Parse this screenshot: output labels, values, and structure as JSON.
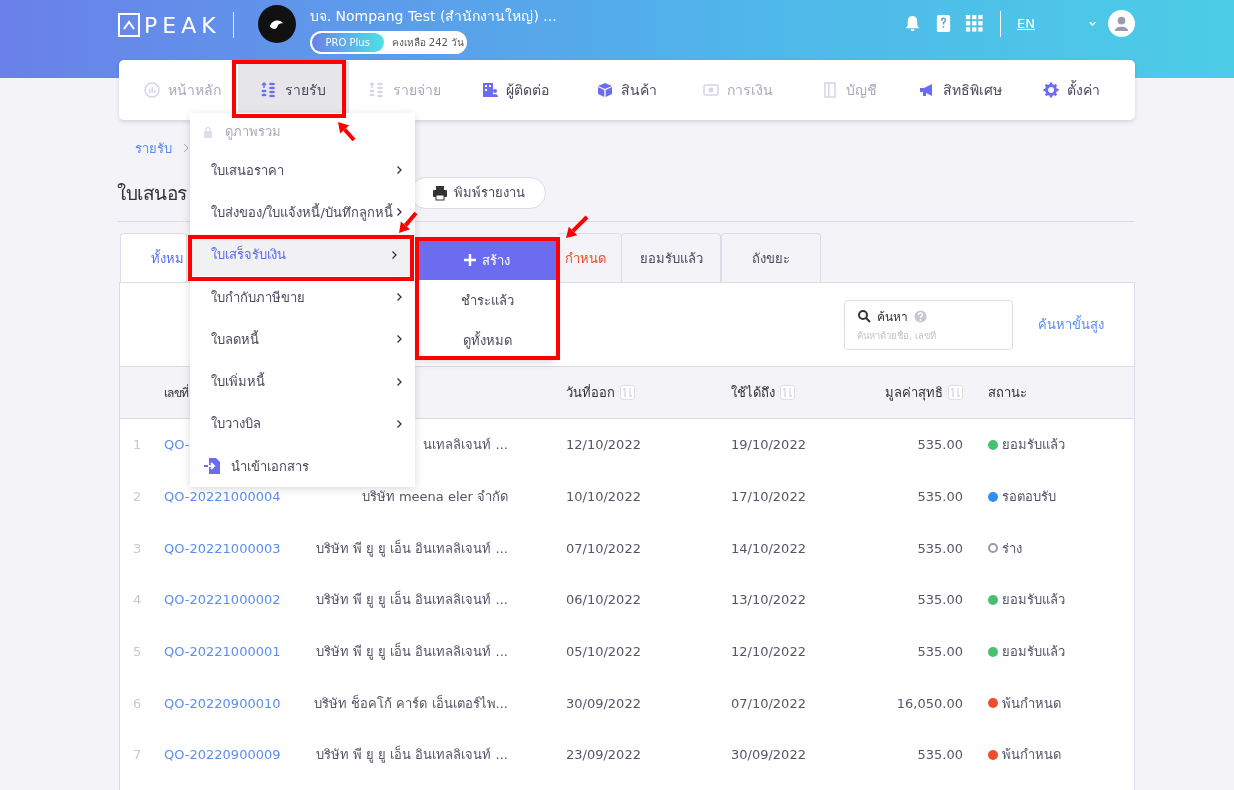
{
  "header": {
    "logo": "PEAK",
    "company": "บจ. Nompang Test (สำนักงานใหญ่) ...",
    "plan": "PRO Plus",
    "remaining": "คงเหลือ 242 วัน",
    "language": "EN"
  },
  "nav": [
    {
      "label": "หน้าหลัก",
      "disabled": true,
      "selected": false
    },
    {
      "label": "รายรับ",
      "disabled": false,
      "selected": true
    },
    {
      "label": "รายจ่าย",
      "disabled": true,
      "selected": false
    },
    {
      "label": "ผู้ติดต่อ",
      "disabled": false,
      "selected": false
    },
    {
      "label": "สินค้า",
      "disabled": false,
      "selected": false
    },
    {
      "label": "การเงิน",
      "disabled": true,
      "selected": false
    },
    {
      "label": "บัญชี",
      "disabled": true,
      "selected": false
    },
    {
      "label": "สิทธิพิเศษ",
      "disabled": false,
      "selected": false
    },
    {
      "label": "ตั้งค่า",
      "disabled": false,
      "selected": false
    }
  ],
  "breadcrumb": [
    "รายรับ"
  ],
  "page_title": "ใบเสนอร",
  "print_button": "พิมพ์รายงาน",
  "tabs": [
    {
      "label": "ทั้งหม",
      "kind": "normal",
      "selected": true
    },
    {
      "label": "กำหนด",
      "kind": "alert",
      "selected": false
    },
    {
      "label": "ยอมรับแล้ว",
      "kind": "normal",
      "selected": false
    },
    {
      "label": "ถังขยะ",
      "kind": "normal",
      "selected": false
    }
  ],
  "search": {
    "label": "ค้นหา",
    "placeholder": "ค้นหาด้วยชื่อ, เลขที่"
  },
  "advanced_search": "ค้นหาขั้นสูง",
  "table": {
    "columns": [
      {
        "label": "เลขที่",
        "sortable": false
      },
      {
        "label": "วันที่ออก",
        "sortable": true
      },
      {
        "label": "ใช้ได้ถึง",
        "sortable": true
      },
      {
        "label": "มูลค่าสุทธิ",
        "sortable": true
      },
      {
        "label": "สถานะ",
        "sortable": false
      }
    ],
    "rows": [
      {
        "index": "1",
        "number": "QO-",
        "customer": "นเทลลิเจนท์ ...",
        "issued": "12/10/2022",
        "valid_until": "19/10/2022",
        "amount": "535.00",
        "status": "ยอมรับแล้ว",
        "kind": "dot",
        "color": "#48c072"
      },
      {
        "index": "2",
        "number": "QO-20221000004",
        "customer": "บริษัท meena eler จำกัด",
        "issued": "10/10/2022",
        "valid_until": "17/10/2022",
        "amount": "535.00",
        "status": "รอตอบรับ",
        "kind": "dot",
        "color": "#2f8ff7"
      },
      {
        "index": "3",
        "number": "QO-20221000003",
        "customer": "บริษัท พี ยู ยู เอ็น อินเทลลิเจนท์ ...",
        "issued": "07/10/2022",
        "valid_until": "14/10/2022",
        "amount": "535.00",
        "status": "ร่าง",
        "kind": "ring",
        "color": "#9a98ab"
      },
      {
        "index": "4",
        "number": "QO-20221000002",
        "customer": "บริษัท พี ยู ยู เอ็น อินเทลลิเจนท์ ...",
        "issued": "06/10/2022",
        "valid_until": "13/10/2022",
        "amount": "535.00",
        "status": "ยอมรับแล้ว",
        "kind": "dot",
        "color": "#48c072"
      },
      {
        "index": "5",
        "number": "QO-20221000001",
        "customer": "บริษัท พี ยู ยู เอ็น อินเทลลิเจนท์ ...",
        "issued": "05/10/2022",
        "valid_until": "12/10/2022",
        "amount": "535.00",
        "status": "ยอมรับแล้ว",
        "kind": "dot",
        "color": "#48c072"
      },
      {
        "index": "6",
        "number": "QO-20220900010",
        "customer": "บริษัท ช็อคโก้ คาร์ด เอ็นเตอร์ไพ...",
        "issued": "30/09/2022",
        "valid_until": "07/10/2022",
        "amount": "16,050.00",
        "status": "พ้นกำหนด",
        "kind": "dot",
        "color": "#ef4d2e"
      },
      {
        "index": "7",
        "number": "QO-20220900009",
        "customer": "บริษัท พี ยู ยู เอ็น อินเทลลิเจนท์ ...",
        "issued": "23/09/2022",
        "valid_until": "30/09/2022",
        "amount": "535.00",
        "status": "พ้นกำหนด",
        "kind": "dot",
        "color": "#ef4d2e"
      }
    ]
  },
  "menu": [
    {
      "label": "ดูภาพรวม",
      "kind": "locked",
      "disabled": true,
      "selected": false
    },
    {
      "label": "ใบเสนอราคา",
      "kind": "submenu",
      "disabled": false,
      "selected": false
    },
    {
      "label": "ใบส่งของ/ใบแจ้งหนี้/บันทึกลูกหนี้",
      "kind": "submenu",
      "disabled": false,
      "selected": false
    },
    {
      "label": "ใบเสร็จรับเงิน",
      "kind": "submenu",
      "disabled": false,
      "selected": true
    },
    {
      "label": "ใบกำกับภาษีขาย",
      "kind": "submenu",
      "disabled": false,
      "selected": false
    },
    {
      "label": "ใบลดหนี้",
      "kind": "submenu",
      "disabled": false,
      "selected": false
    },
    {
      "label": "ใบเพิ่มหนี้",
      "kind": "submenu",
      "disabled": false,
      "selected": false
    },
    {
      "label": "ใบวางบิล",
      "kind": "submenu",
      "disabled": false,
      "selected": false
    },
    {
      "label": "นำเข้าเอกสาร",
      "kind": "import",
      "disabled": false,
      "selected": false
    }
  ],
  "submenu": [
    {
      "label": "สร้าง",
      "kind": "create",
      "selected": true
    },
    {
      "label": "ชำระแล้ว",
      "kind": "plain",
      "selected": false
    },
    {
      "label": "ดูทั้งหมด",
      "kind": "plain",
      "selected": false
    }
  ]
}
